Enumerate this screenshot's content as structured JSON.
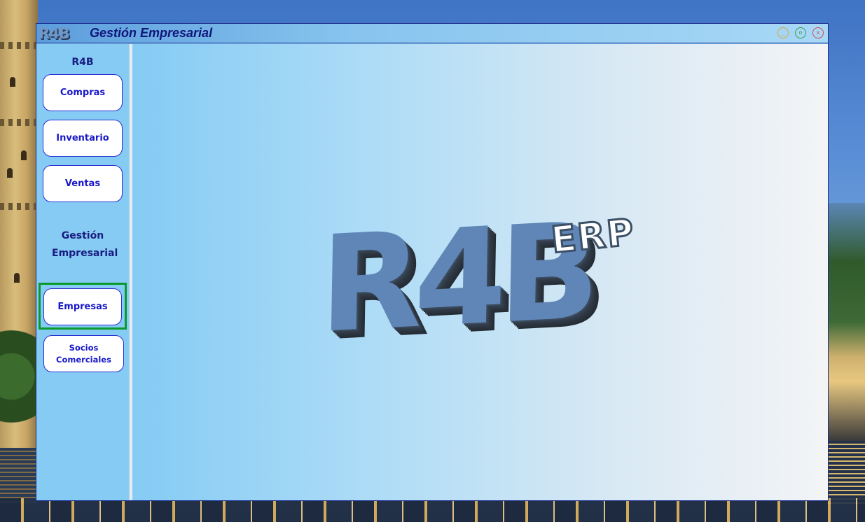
{
  "window": {
    "logo_text": "R4B",
    "title": "Gestión Empresarial",
    "controls": {
      "minimize": "_",
      "maximize": "o",
      "close": "x"
    }
  },
  "sidebar": {
    "section1_title": "R4B",
    "section1_items": [
      {
        "label": "Compras"
      },
      {
        "label": "Inventario"
      },
      {
        "label": "Ventas"
      }
    ],
    "section2_title": "Gestión Empresarial",
    "section2_items": [
      {
        "label": "Empresas",
        "focused": true
      },
      {
        "label": "Socios Comerciales"
      }
    ]
  },
  "hero": {
    "brand": "R4B",
    "product": "ERP"
  },
  "colors": {
    "accent_text": "#1818c8",
    "title_text": "#10167a",
    "focus_ring": "#0a9a2a",
    "panel_bg": "#85cbf4"
  }
}
